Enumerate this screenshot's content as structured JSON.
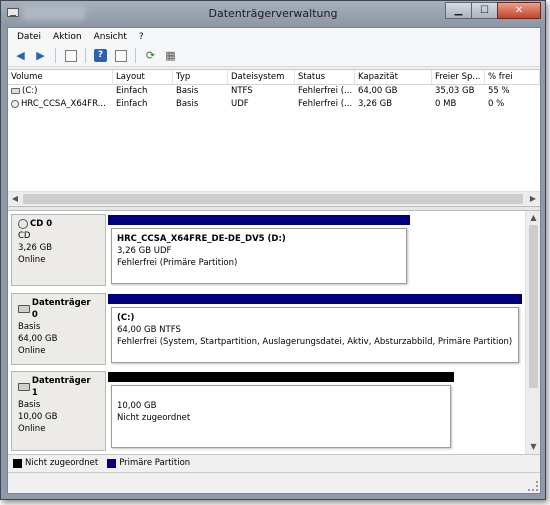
{
  "window": {
    "title": "Datenträgerverwaltung",
    "caption": {
      "minimize": "▁",
      "maximize": "☐",
      "close": "✕"
    }
  },
  "menu": [
    "Datei",
    "Aktion",
    "Ansicht",
    "?"
  ],
  "volume_list": {
    "columns": [
      "Volume",
      "Layout",
      "Typ",
      "Dateisystem",
      "Status",
      "Kapazität",
      "Freier Sp...",
      "% frei"
    ],
    "rows": [
      {
        "icon": "drive-icon",
        "cells": [
          "(C:)",
          "Einfach",
          "Basis",
          "NTFS",
          "Fehlerfrei (...",
          "64,00 GB",
          "35,03 GB",
          "55 %"
        ]
      },
      {
        "icon": "cd-icon",
        "cells": [
          "HRC_CCSA_X64FR...",
          "Einfach",
          "Basis",
          "UDF",
          "Fehlerfrei (...",
          "3,26 GB",
          "0 MB",
          "0 %"
        ]
      }
    ]
  },
  "disks": [
    {
      "name": "CD 0",
      "icon": "cd-drive-icon",
      "type": "CD",
      "size": "3,26 GB",
      "status": "Online",
      "partition": {
        "name": "HRC_CCSA_X64FRE_DE-DE_DV5  (D:)",
        "detail": "3,26 GB UDF",
        "status": "Fehlerfrei (Primäre Partition)",
        "color": "#00007f"
      }
    },
    {
      "name": "Datenträger 0",
      "icon": "disk-icon",
      "type": "Basis",
      "size": "64,00 GB",
      "status": "Online",
      "partition": {
        "name": "(C:)",
        "detail": "64,00 GB NTFS",
        "status": "Fehlerfrei (System, Startpartition, Auslagerungsdatei, Aktiv, Absturzabbild, Primäre Partition)",
        "color": "#00007f"
      }
    },
    {
      "name": "Datenträger 1",
      "icon": "disk-icon",
      "type": "Basis",
      "size": "10,00 GB",
      "status": "Online",
      "partition": {
        "name": "",
        "detail": "10,00 GB",
        "status": "Nicht zugeordnet",
        "color": "#000000"
      }
    }
  ],
  "legend": [
    {
      "label": "Nicht zugeordnet",
      "color": "#000000"
    },
    {
      "label": "Primäre Partition",
      "color": "#00007f"
    }
  ]
}
